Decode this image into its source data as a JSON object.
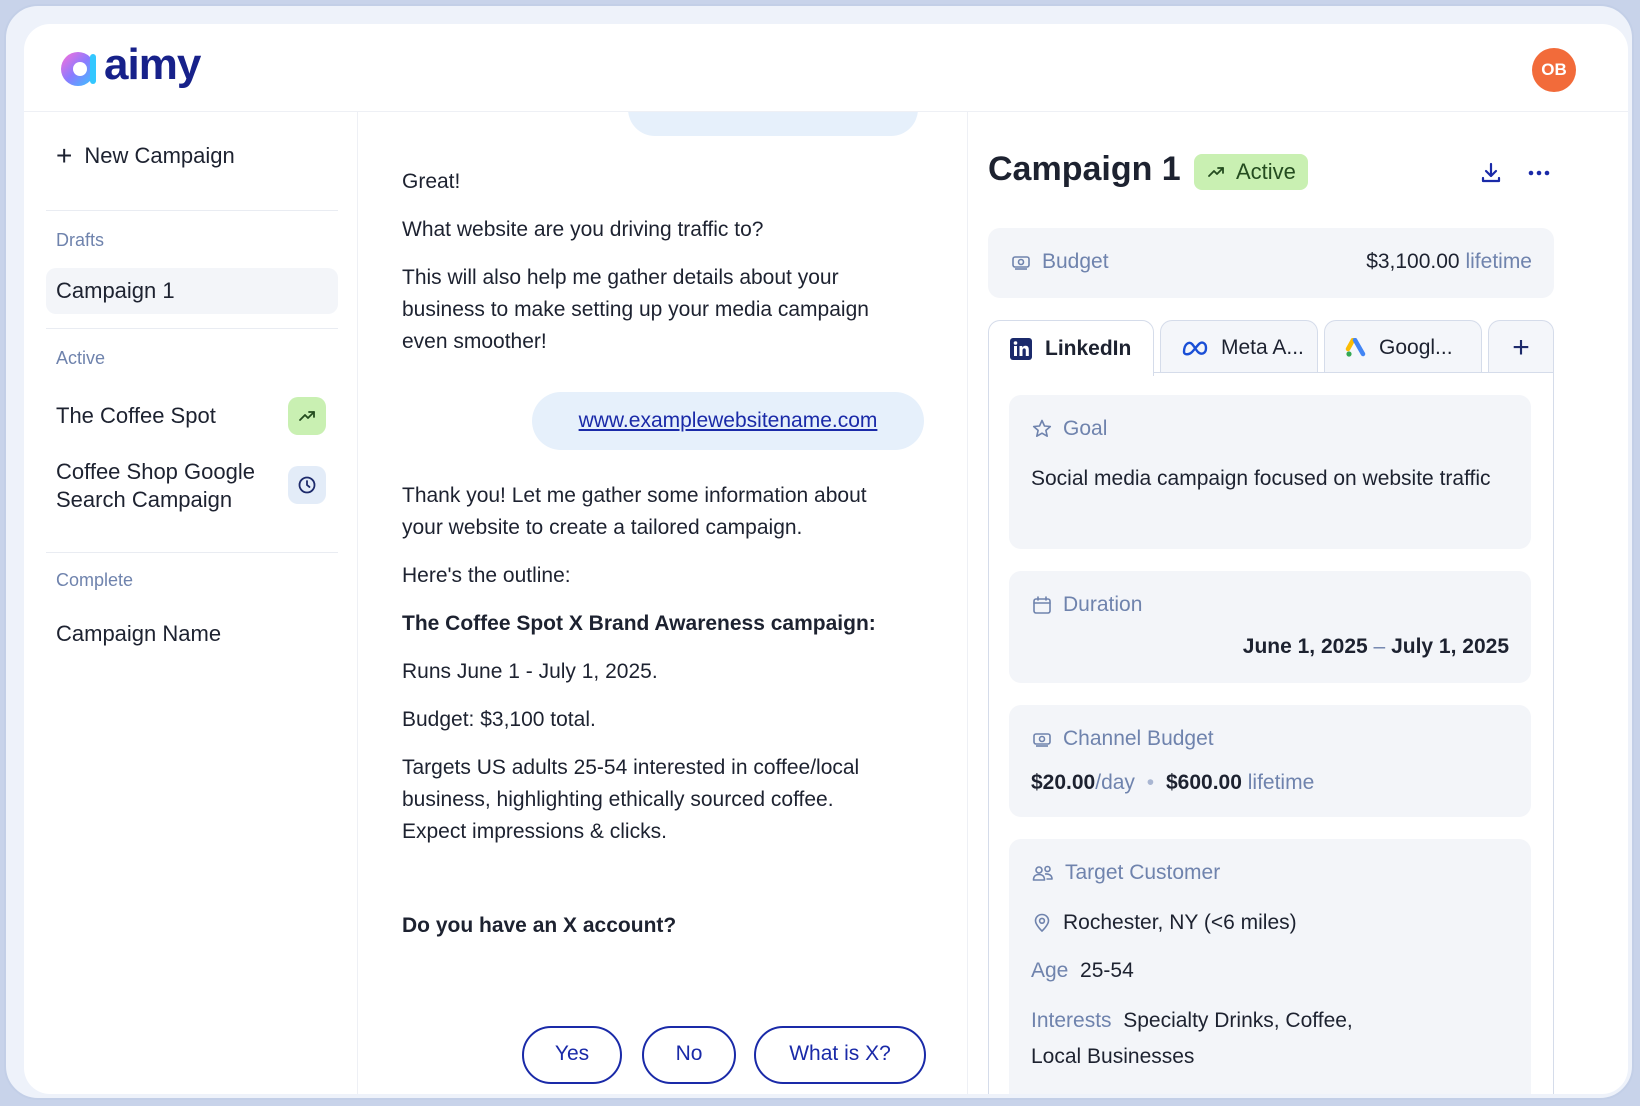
{
  "brand": {
    "name": "aimy"
  },
  "user": {
    "initials": "OB"
  },
  "sidebar": {
    "new_campaign": "New Campaign",
    "sections": {
      "drafts": "Drafts",
      "active": "Active",
      "complete": "Complete"
    },
    "drafts": [
      {
        "name": "Campaign 1"
      }
    ],
    "active": [
      {
        "name": "The Coffee Spot",
        "status_icon": "trending-up-icon"
      },
      {
        "name_line1": "Coffee Shop Google",
        "name_line2": "Search Campaign",
        "status_icon": "clock-icon"
      }
    ],
    "complete": [
      {
        "name": "Campaign Name"
      }
    ]
  },
  "chat": {
    "messages": [
      "Great!",
      "What website are you driving traffic to?",
      "This will also help me gather details about your business to make setting up your media campaign even smoother!"
    ],
    "user_link": "www.examplewebsitename.com",
    "reply": {
      "thanks": "Thank you! Let me gather some information about your website to create a tailored campaign.",
      "outline_intro": "Here's the outline:",
      "outline_title": "The Coffee Spot X Brand Awareness campaign:",
      "runs": "Runs June 1 - July 1, 2025.",
      "budget": "Budget: $3,100 total.",
      "targets": "Targets US adults 25-54 interested in coffee/local business, highlighting ethically sourced coffee. Expect impressions & clicks.",
      "question": "Do you have an X account?"
    },
    "quick_replies": [
      "Yes",
      "No",
      "What is X?"
    ]
  },
  "panel": {
    "title": "Campaign 1",
    "status": "Active",
    "budget": {
      "label": "Budget",
      "amount": "$3,100.00",
      "period": "lifetime"
    },
    "tabs": [
      {
        "label": "LinkedIn",
        "icon": "linkedin-icon"
      },
      {
        "label": "Meta A...",
        "icon": "meta-icon"
      },
      {
        "label": "Googl...",
        "icon": "google-ads-icon"
      }
    ],
    "goal": {
      "label": "Goal",
      "text": "Social media campaign focused on website traffic"
    },
    "duration": {
      "label": "Duration",
      "start": "June 1, 2025",
      "separator": "–",
      "end": "July 1, 2025"
    },
    "channel_budget": {
      "label": "Channel Budget",
      "daily": "$20.00",
      "daily_unit": "/day",
      "lifetime": "$600.00",
      "lifetime_unit": "lifetime"
    },
    "target": {
      "label": "Target Customer",
      "location": "Rochester, NY (<6 miles)",
      "age_label": "Age",
      "age": "25-54",
      "interests_label": "Interests",
      "interests_line1": "Specialty Drinks,  Coffee,",
      "interests_line2": "Local Businesses"
    }
  },
  "colors": {
    "brand": "#17218a",
    "accent": "#1a2aa8",
    "active_badge": "#c9f0b2",
    "avatar": "#f26b3a",
    "muted": "#6f83ad"
  }
}
